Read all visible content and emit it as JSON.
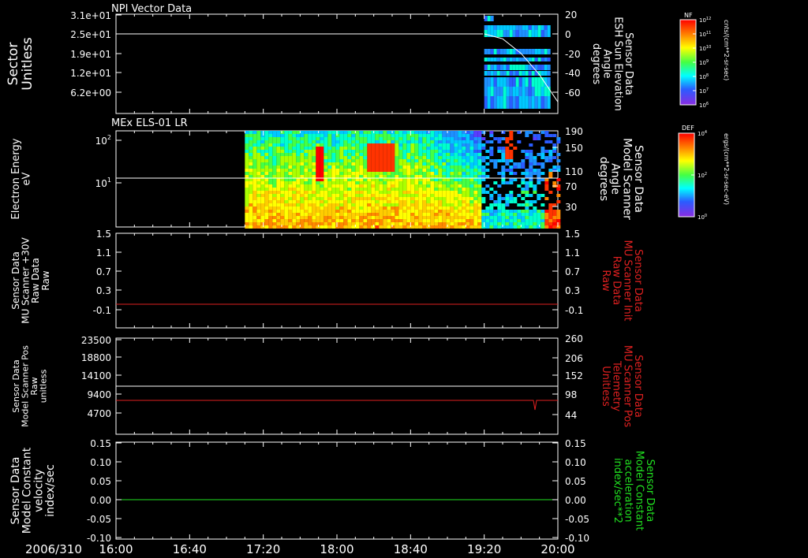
{
  "date_label": "2006/310",
  "time_ticks": [
    "16:00",
    "16:40",
    "17:20",
    "18:00",
    "18:40",
    "19:20",
    "20:00"
  ],
  "panels": [
    {
      "title": "NPI Vector Data",
      "left_label": [
        "Sector",
        "Unitless"
      ],
      "left_ticks": [
        "3.1e+01",
        "2.5e+01",
        "1.9e+01",
        "1.2e+01",
        "6.2e+00"
      ],
      "right_label": [
        "Sensor Data",
        "ESH Sun Elevation",
        "Angle",
        "degrees"
      ],
      "right_ticks": [
        "20",
        "0",
        "-20",
        "-40",
        "-60"
      ],
      "colorbar": {
        "name": "NF",
        "unit": "cnts/(cm**2-sr-sec)",
        "ticks": [
          "10^12",
          "10^11",
          "10^10",
          "10^9",
          "10^8",
          "10^7",
          "10^6"
        ]
      }
    },
    {
      "title": "MEx ELS-01 LR",
      "left_label": [
        "Electron Energy",
        "eV"
      ],
      "left_ticks": [
        "10^2",
        "10^1"
      ],
      "right_label": [
        "Sensor Data",
        "Model Scanner",
        "Angle",
        "degrees"
      ],
      "right_ticks": [
        "190",
        "150",
        "110",
        "70",
        "30"
      ],
      "colorbar": {
        "name": "DEF",
        "unit": "ergs/(cm**2-sr-sec-eV)",
        "ticks": [
          "10^4",
          "10^2",
          "10^0"
        ]
      }
    },
    {
      "title": "",
      "left_label": [
        "Sensor Data",
        "MU Scanner +30V",
        "Raw Data",
        "Raw"
      ],
      "left_ticks": [
        "1.5",
        "1.1",
        "0.7",
        "0.3",
        "-0.1"
      ],
      "right_label": [
        "Sensor Data",
        "MU Scanner Init",
        "Raw Data",
        "Raw"
      ],
      "right_ticks": [
        "1.5",
        "1.1",
        "0.7",
        "0.3",
        "-0.1"
      ]
    },
    {
      "title": "",
      "left_label": [
        "Sensor Data",
        "Model Scanner Pos",
        "Raw",
        "unitless"
      ],
      "left_ticks": [
        "23500",
        "18800",
        "14100",
        "9400",
        "4700"
      ],
      "right_label": [
        "Sensor Data",
        "MU Scanner Pos",
        "Telemetry",
        "Unitless"
      ],
      "right_ticks": [
        "260",
        "206",
        "152",
        "98",
        "44"
      ]
    },
    {
      "title": "",
      "left_label": [
        "Sensor Data",
        "Model Constant",
        "velocity",
        "index/sec"
      ],
      "left_ticks": [
        "0.15",
        "0.10",
        "0.05",
        "0.00",
        "-0.05",
        "-0.10"
      ],
      "right_label": [
        "Sensor Data",
        "Model Constant",
        "acceleration",
        "index/sec**2"
      ],
      "right_ticks": [
        "0.15",
        "0.10",
        "0.05",
        "0.00",
        "-0.05",
        "-0.10"
      ]
    }
  ],
  "colors": {
    "axis": "#ffffff",
    "red_trace": "#e02020",
    "green_trace": "#20e020"
  },
  "chart_data": [
    {
      "type": "heatmap",
      "title": "NPI Vector Data",
      "ylabel": "Sector",
      "ylim": [
        0,
        31
      ],
      "xlim": [
        "16:00",
        "20:00"
      ],
      "data_span": [
        "19:20",
        "19:55"
      ],
      "series": [
        {
          "name": "ESH Sun Elevation Angle",
          "x": [
            "19:20",
            "19:30",
            "19:40",
            "19:50",
            "20:00"
          ],
          "values": [
            0,
            -5,
            -20,
            -42,
            -70
          ]
        }
      ],
      "hline": 25
    },
    {
      "type": "heatmap",
      "title": "MEx ELS-01 LR",
      "ylabel": "Electron Energy",
      "ylog": true,
      "xlim": [
        "16:00",
        "20:00"
      ],
      "data_span": [
        "17:10",
        "20:00"
      ],
      "hline_energy": 15
    },
    {
      "type": "line",
      "xlim": [
        "16:00",
        "20:00"
      ],
      "ylim": [
        -0.3,
        1.5
      ],
      "series": [
        {
          "name": "MU Scanner Init",
          "x": [
            "16:00",
            "20:00"
          ],
          "values": [
            0,
            0
          ]
        }
      ]
    },
    {
      "type": "line",
      "xlim": [
        "16:00",
        "20:00"
      ],
      "ylim": [
        0,
        23500
      ],
      "series": [
        {
          "name": "Model Scanner Pos",
          "x": [
            "16:00",
            "20:00"
          ],
          "values": [
            11800,
            11800
          ]
        },
        {
          "name": "MU Scanner Pos",
          "x": [
            "16:00",
            "19:50",
            "19:51",
            "19:52",
            "20:00"
          ],
          "values": [
            98,
            98,
            88,
            98,
            98
          ]
        }
      ]
    },
    {
      "type": "line",
      "xlim": [
        "16:00",
        "20:00"
      ],
      "ylim": [
        -0.1,
        0.15
      ],
      "series": [
        {
          "name": "Model Constant acceleration",
          "x": [
            "16:00",
            "20:00"
          ],
          "values": [
            0,
            0
          ]
        }
      ]
    }
  ]
}
